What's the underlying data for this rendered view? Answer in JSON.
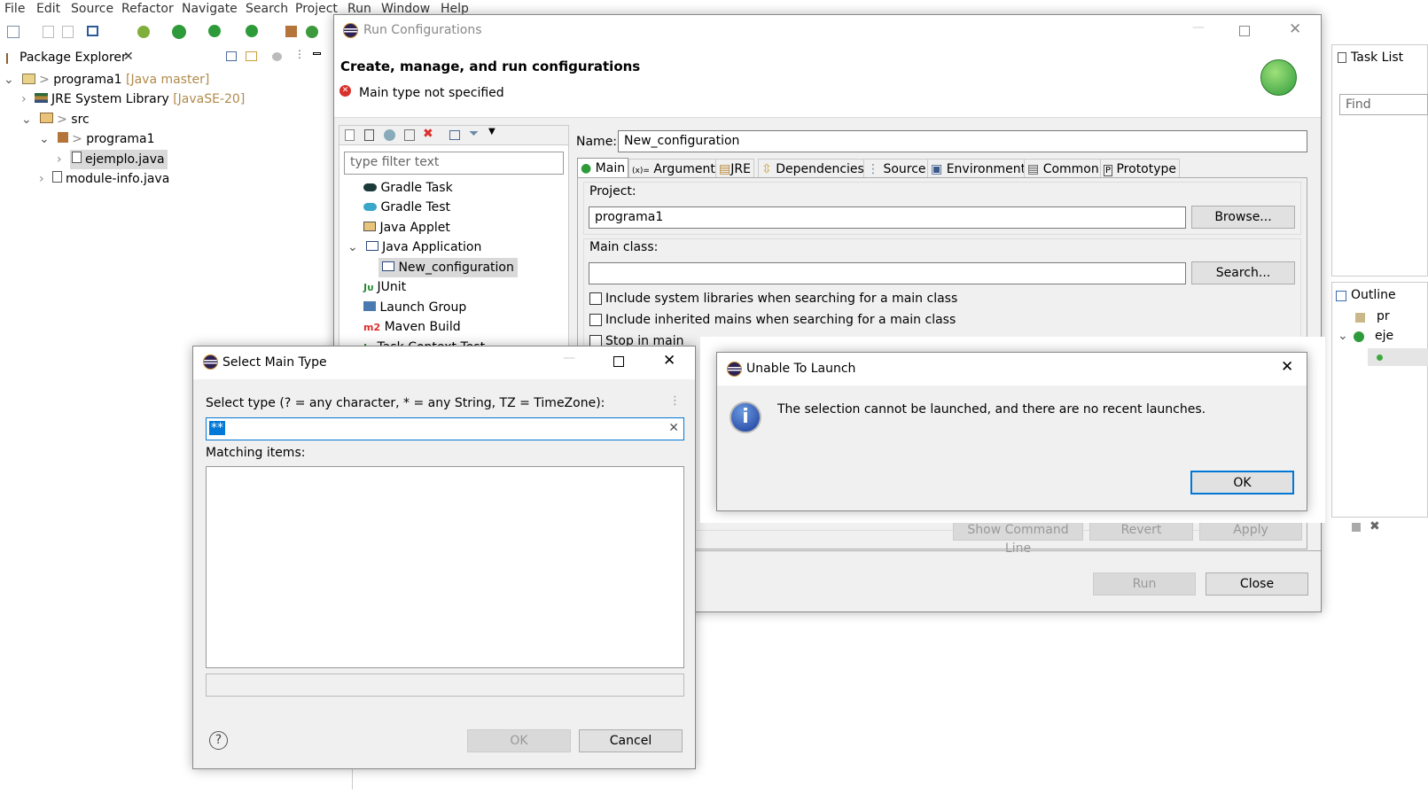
{
  "menu": [
    "File",
    "Edit",
    "Source",
    "Refactor",
    "Navigate",
    "Search",
    "Project",
    "Run",
    "Window",
    "Help"
  ],
  "package_explorer": {
    "title": "Package Explorer",
    "tree": [
      {
        "label": "programa1",
        "decoration": "[Java master]",
        "prefix": ">"
      },
      {
        "label": "JRE System Library",
        "decoration": "[JavaSE-20]"
      },
      {
        "label": "src",
        "prefix": ">"
      },
      {
        "label": "programa1",
        "prefix": ">"
      },
      {
        "label": "ejemplo.java",
        "selected": true
      },
      {
        "label": "module-info.java"
      }
    ]
  },
  "run_config": {
    "title": "Run Configurations",
    "header": "Create, manage, and run configurations",
    "error": "Main type not specified",
    "filter_placeholder": "type filter text",
    "types": [
      "Gradle Task",
      "Gradle Test",
      "Java Applet",
      "Java Application",
      "New_configuration",
      "JUnit",
      "Launch Group",
      "Maven Build",
      "Task Context Test"
    ],
    "name_label": "Name:",
    "name_value": "New_configuration",
    "tabs": [
      "Main",
      "Arguments",
      "JRE",
      "Dependencies",
      "Source",
      "Environment",
      "Common",
      "Prototype"
    ],
    "project_label": "Project:",
    "project_value": "programa1",
    "browse": "Browse...",
    "main_class_label": "Main class:",
    "main_class_value": "",
    "search": "Search...",
    "checks": [
      "Include system libraries when searching for a main class",
      "Include inherited mains when searching for a main class",
      "Stop in main"
    ],
    "show_cmd": "Show Command Line",
    "revert": "Revert",
    "apply": "Apply",
    "run": "Run",
    "close": "Close"
  },
  "select_main": {
    "title": "Select Main Type",
    "prompt": "Select type (? = any character, * = any String, TZ = TimeZone):",
    "filter_value": "**",
    "matching": "Matching items:",
    "ok": "OK",
    "cancel": "Cancel"
  },
  "unable": {
    "title": "Unable To Launch",
    "message": "The selection cannot be launched, and there are no recent launches.",
    "ok": "OK"
  },
  "right": {
    "task_list": "Task List",
    "find_placeholder": "Find",
    "outline": "Outline",
    "outline_items": [
      "pr",
      "eje"
    ]
  },
  "colors": {
    "accent": "#0078d7",
    "selection": "#d9d9d9",
    "error": "#d9302c"
  }
}
